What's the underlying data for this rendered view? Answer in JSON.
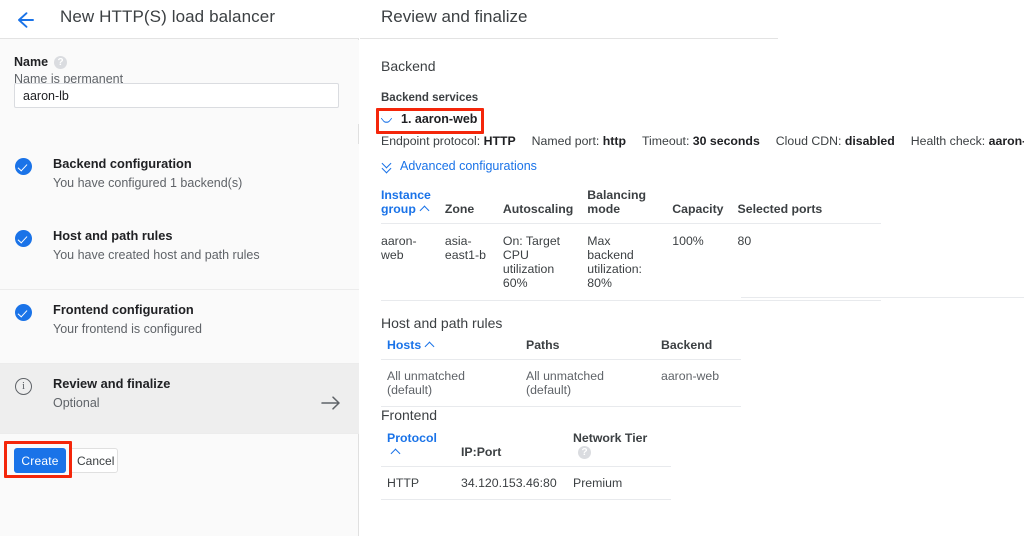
{
  "wizard": {
    "back_icon": "arrow-left-icon",
    "title": "New HTTP(S) load balancer",
    "name_label": "Name",
    "name_help_icon": "help-icon",
    "name_hint": "Name is permanent",
    "name_value": "aaron-lb",
    "name_placeholder": "",
    "steps": [
      {
        "icon": "check-circle-icon",
        "title": "Backend configuration",
        "subtitle": "You have configured 1 backend(s)",
        "state": "complete"
      },
      {
        "icon": "check-circle-icon",
        "title": "Host and path rules",
        "subtitle": "You have created host and path rules",
        "state": "complete"
      },
      {
        "icon": "check-circle-icon",
        "title": "Frontend configuration",
        "subtitle": "Your frontend is configured",
        "state": "complete"
      },
      {
        "icon": "info-circle-icon",
        "title": "Review and finalize",
        "subtitle": "Optional",
        "state": "active",
        "arrow_icon": "arrow-right-icon"
      }
    ],
    "create_label": "Create",
    "cancel_label": "Cancel"
  },
  "review": {
    "title": "Review and finalize",
    "backend": {
      "section_title": "Backend",
      "services_label": "Backend services",
      "service_name": "1. aaron-web",
      "service_toggle_icon": "chevron-down-icon",
      "meta": [
        {
          "key": "Endpoint protocol:",
          "value": "HTTP"
        },
        {
          "key": "Named port:",
          "value": "http"
        },
        {
          "key": "Timeout:",
          "value": "30 seconds"
        },
        {
          "key": "Cloud CDN:",
          "value": "disabled"
        },
        {
          "key": "Health check:",
          "value": "aaron-http-check"
        }
      ],
      "advanced_link": "Advanced configurations",
      "advanced_icon": "double-chevron-down-icon",
      "table": {
        "columns": [
          "Instance group",
          "Zone",
          "Autoscaling",
          "Balancing mode",
          "Capacity",
          "Selected ports"
        ],
        "sorted_column": "Instance group",
        "sort_icon": "caret-up-icon",
        "rows": [
          [
            "aaron-web",
            "asia-east1-b",
            "On: Target CPU utilization 60%",
            "Max backend utilization: 80%",
            "100%",
            "80"
          ]
        ]
      }
    },
    "host_path_rules": {
      "section_title": "Host and path rules",
      "table": {
        "columns": [
          "Hosts",
          "Paths",
          "Backend"
        ],
        "sorted_column": "Hosts",
        "sort_icon": "caret-up-icon",
        "rows": [
          [
            "All unmatched (default)",
            "All unmatched (default)",
            "aaron-web"
          ]
        ]
      }
    },
    "frontend": {
      "section_title": "Frontend",
      "table": {
        "columns": [
          "Protocol",
          "IP:Port",
          "Network Tier"
        ],
        "sorted_column": "Protocol",
        "sort_icon": "caret-up-icon",
        "network_tier_help_icon": "help-icon",
        "rows": [
          [
            "HTTP",
            "34.120.153.46:80",
            "Premium"
          ]
        ]
      }
    }
  },
  "annotations": [
    {
      "name": "create-button-highlight",
      "color": "#f4260a"
    },
    {
      "name": "backend-service-highlight",
      "color": "#f4260a"
    }
  ],
  "colors": {
    "accent": "#1a73e8",
    "annotation": "#f4260a",
    "panel_bg": "#fafafa",
    "active_step_bg": "#eeeeee",
    "text_primary": "#202124",
    "text_secondary": "#5f6368"
  }
}
